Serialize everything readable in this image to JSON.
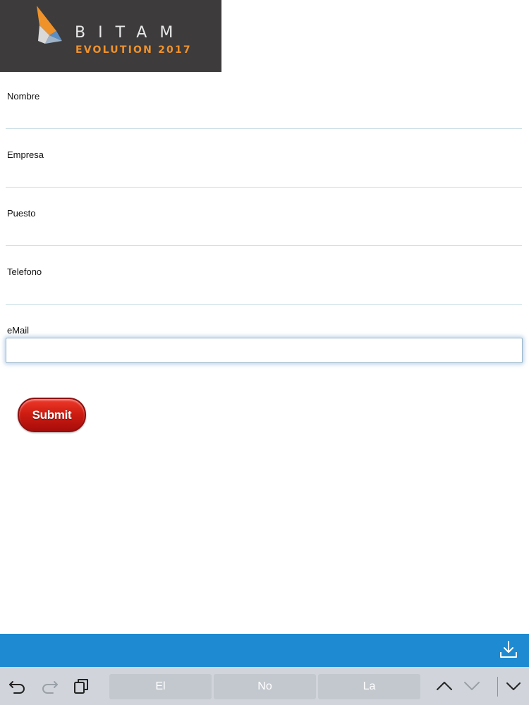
{
  "logo": {
    "word": "BITAM",
    "subtitle": "EVOLUTION 2017",
    "colors": {
      "background": "#3d3b3c",
      "accent": "#f0922a"
    }
  },
  "form": {
    "fields": [
      {
        "label": "Nombre",
        "value": ""
      },
      {
        "label": "Empresa",
        "value": ""
      },
      {
        "label": "Puesto",
        "value": ""
      },
      {
        "label": "Telefono",
        "value": ""
      },
      {
        "label": "eMail",
        "value": "",
        "focused": true
      }
    ],
    "submit_label": "Submit",
    "submit_color": "#cf1d12"
  },
  "bottom_bar": {
    "color": "#1e8ad1",
    "icon": "download-icon"
  },
  "keyboard_bar": {
    "icons": [
      "undo-icon",
      "redo-icon",
      "clipboard-icon",
      "chevron-up-icon",
      "chevron-down-icon",
      "hide-keyboard-icon"
    ],
    "suggestions": [
      "El",
      "No",
      "La"
    ]
  }
}
